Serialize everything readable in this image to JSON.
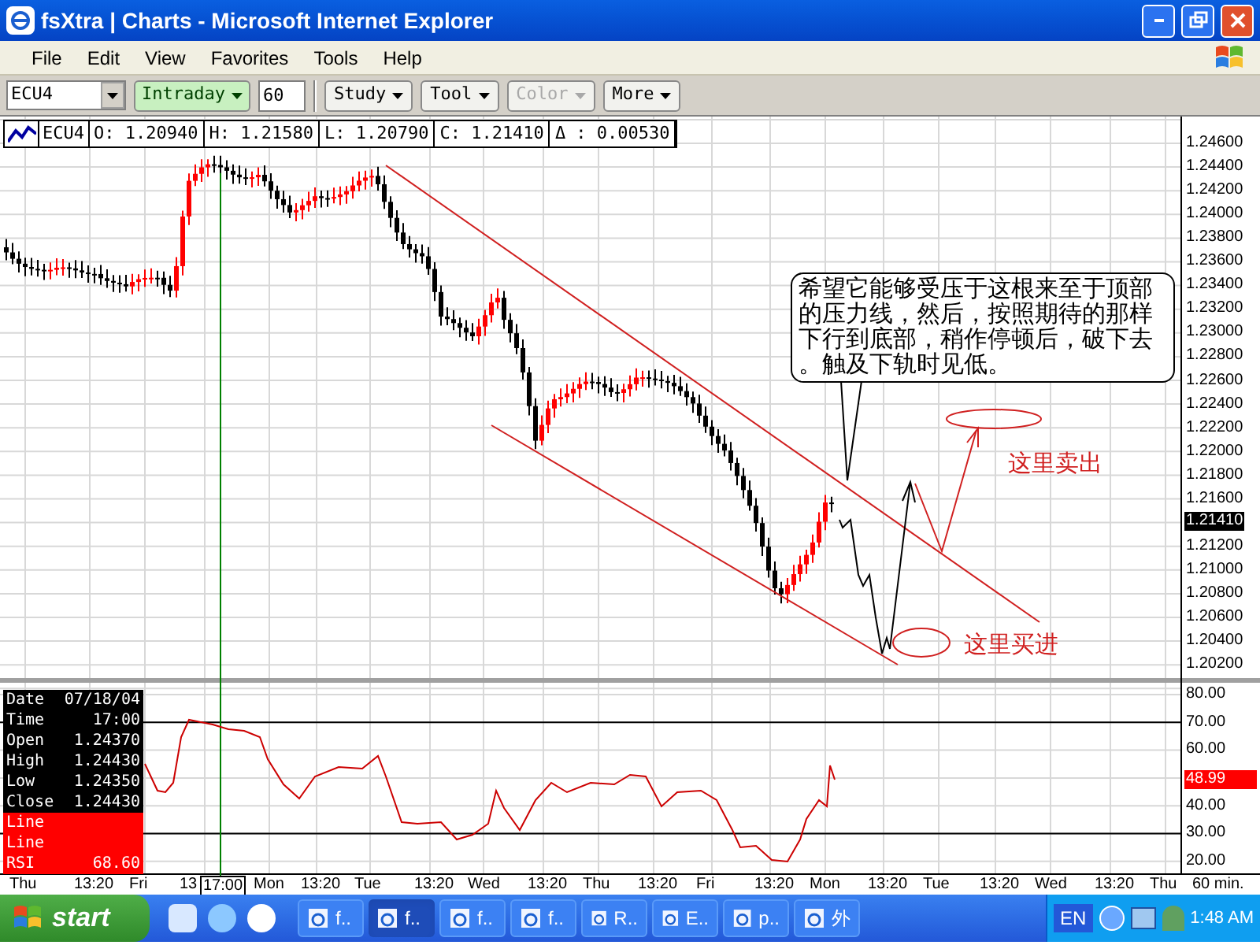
{
  "window": {
    "title": "fsXtra | Charts - Microsoft Internet Explorer"
  },
  "menu": [
    "File",
    "Edit",
    "View",
    "Favorites",
    "Tools",
    "Help"
  ],
  "toolbar": {
    "symbol": "ECU4",
    "interval": "Intraday",
    "period": "60",
    "buttons": [
      {
        "label": "Study",
        "disabled": false
      },
      {
        "label": "Tool",
        "disabled": false
      },
      {
        "label": "Color",
        "disabled": true
      },
      {
        "label": "More",
        "disabled": false
      }
    ]
  },
  "quote": {
    "symbol": "ECU4",
    "fields": [
      "O: 1.20940",
      "H: 1.21580",
      "L: 1.20790",
      "C: 1.21410",
      "Δ : 0.00530"
    ]
  },
  "price_axis": {
    "labels": [
      "1.24600",
      "1.24400",
      "1.24200",
      "1.24000",
      "1.23800",
      "1.23600",
      "1.23400",
      "1.23200",
      "1.23000",
      "1.22800",
      "1.22600",
      "1.22400",
      "1.22200",
      "1.22000",
      "1.21800",
      "1.21600",
      "1.21200",
      "1.21000",
      "1.20800",
      "1.20600",
      "1.20400",
      "1.20200"
    ],
    "current": "1.21410"
  },
  "annotations": {
    "callout": "希望它能够受压于这根来至于顶部的压力线，然后，按照期待的那样下行到底部，稍作停顿后，破下去。触及下轨时见低。",
    "sell_label": "这里卖出",
    "buy_label": "这里买进"
  },
  "data_window": [
    {
      "label": "Date",
      "value": "07/18/04",
      "kind": "quote"
    },
    {
      "label": "Time",
      "value": "17:00",
      "kind": "quote"
    },
    {
      "label": "Open",
      "value": "1.24370",
      "kind": "quote"
    },
    {
      "label": "High",
      "value": "1.24430",
      "kind": "quote"
    },
    {
      "label": "Low",
      "value": "1.24350",
      "kind": "quote"
    },
    {
      "label": "Close",
      "value": "1.24430",
      "kind": "quote"
    },
    {
      "label": "Line",
      "kind": "indicator"
    },
    {
      "label": "Line",
      "kind": "indicator"
    },
    {
      "label": "RSI",
      "value": "68.60",
      "kind": "indicator"
    }
  ],
  "rsi_axis": {
    "labels": [
      "80.00",
      "70.00",
      "60.00",
      "40.00",
      "30.00",
      "20.00"
    ],
    "current": "48.99"
  },
  "time_axis": {
    "labels": [
      "Thu",
      "13:20",
      "Fri",
      "13",
      "Mon",
      "13:20",
      "Tue",
      "13:20",
      "Wed",
      "13:20",
      "Thu",
      "13:20",
      "Fri",
      "13:20",
      "Mon",
      "13:20",
      "Tue",
      "13:20",
      "Wed",
      "13:20",
      "Thu"
    ],
    "cursor": "17:00",
    "unit": "60 min."
  },
  "taskbar": {
    "start": "start",
    "tasks": [
      {
        "label": "f..",
        "selected": false
      },
      {
        "label": "f..",
        "selected": true
      },
      {
        "label": "f..",
        "selected": false
      },
      {
        "label": "f..",
        "selected": false
      },
      {
        "label": "R..",
        "selected": false
      },
      {
        "label": "E..",
        "selected": false
      },
      {
        "label": "p..",
        "selected": false
      },
      {
        "label": "外",
        "selected": false
      }
    ],
    "language": "EN",
    "clock": "1:48 AM"
  }
}
